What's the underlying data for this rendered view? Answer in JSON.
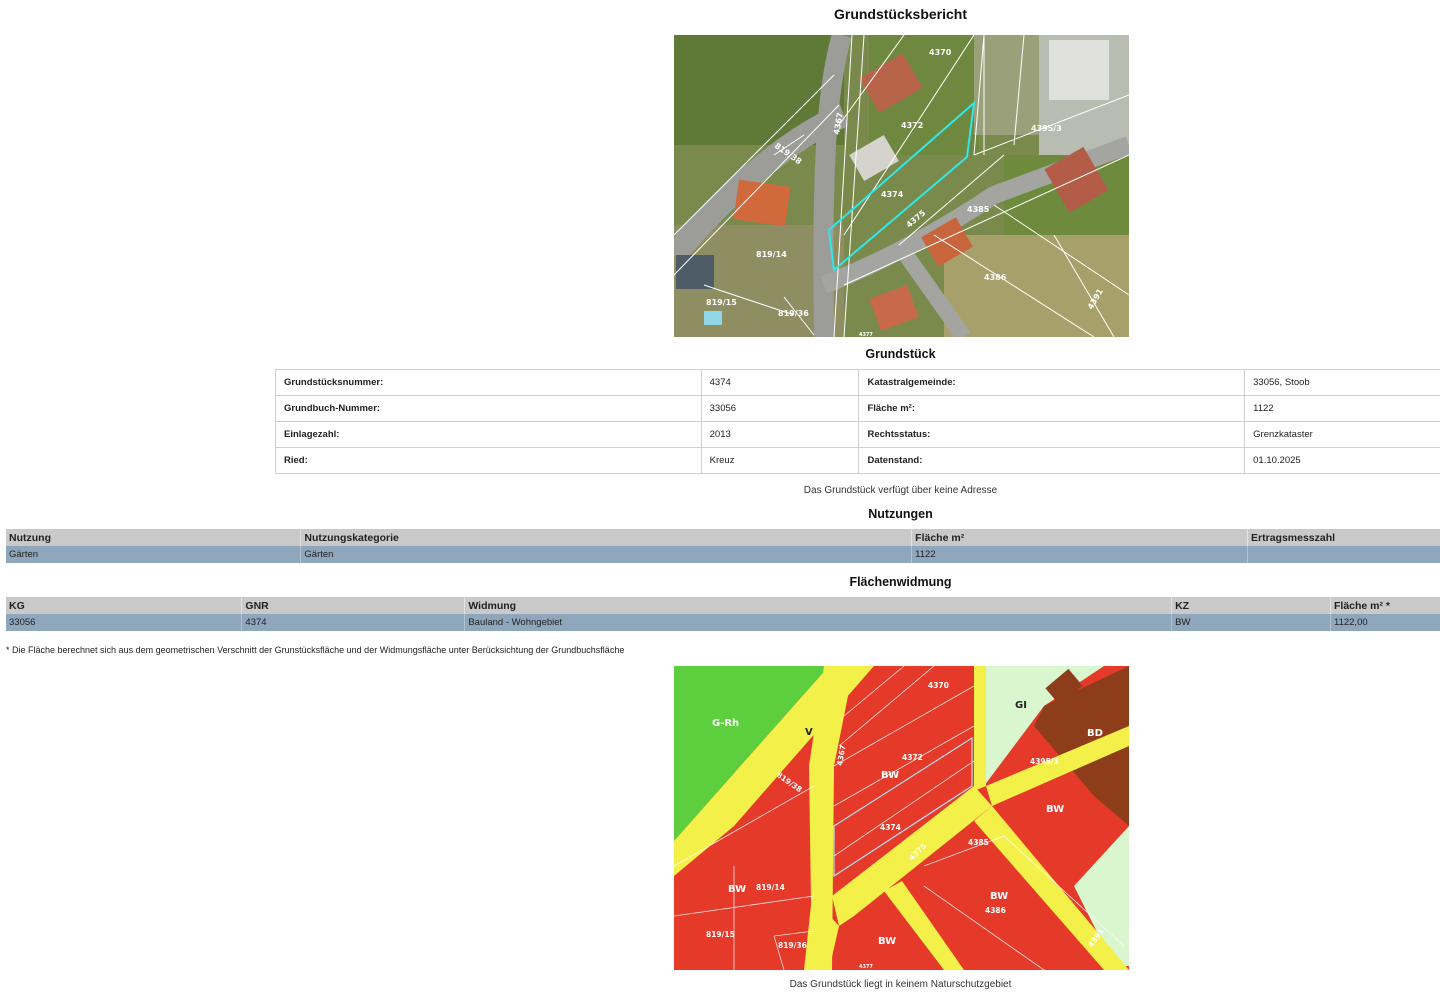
{
  "report": {
    "title": "Grundstücksbericht"
  },
  "aerial_map": {
    "parcel_labels": [
      "4370",
      "4372",
      "4374",
      "4395/3",
      "819/38",
      "4367",
      "4385",
      "4375",
      "819/14",
      "4386",
      "819/15",
      "819/36",
      "4391",
      "4377"
    ]
  },
  "parcel": {
    "heading": "Grundstück",
    "rows": [
      {
        "label1": "Grundstücksnummer:",
        "value1": "4374",
        "label2": "Katastralgemeinde:",
        "value2": "33056, Stoob"
      },
      {
        "label1": "Grundbuch-Nummer:",
        "value1": "33056",
        "label2": "Fläche m²:",
        "value2": "1122"
      },
      {
        "label1": "Einlagezahl:",
        "value1": "2013",
        "label2": "Rechtsstatus:",
        "value2": "Grenzkataster"
      },
      {
        "label1": "Ried:",
        "value1": "Kreuz",
        "label2": "Datenstand:",
        "value2": "01.10.2025"
      }
    ],
    "address_note": "Das Grundstück verfügt über keine Adresse"
  },
  "usage": {
    "heading": "Nutzungen",
    "columns": [
      "Nutzung",
      "Nutzungskategorie",
      "Fläche m²",
      "Ertragsmesszahl"
    ],
    "row": [
      "Gärten",
      "Gärten",
      "1122",
      ""
    ]
  },
  "zoning": {
    "heading": "Flächenwidmung",
    "columns": [
      "KG",
      "GNR",
      "Widmung",
      "KZ",
      "Fläche m² *"
    ],
    "row": [
      "33056",
      "4374",
      "Bauland - Wohngebiet",
      "BW",
      "1122,00"
    ],
    "footnote": "* Die Fläche berechnet sich aus dem geometrischen Verschnitt der Grunstücksfläche und der Widmungsfläche unter Berücksichtung der Grundbuchsfläche"
  },
  "zoning_map": {
    "zone_labels": [
      "G-Rh",
      "V",
      "GI",
      "BD",
      "BW",
      "BW",
      "BW",
      "BW",
      "BW",
      "BW"
    ],
    "parcel_labels": [
      "4370",
      "4372",
      "4374",
      "4395/3",
      "819/38",
      "4367",
      "4385",
      "4375",
      "819/14",
      "4386",
      "819/15",
      "819/36",
      "4391",
      "4377"
    ],
    "colors": {
      "residential": "#e53a2a",
      "road": "#f4f04a",
      "green": "#5dcf3e",
      "industrial": "#d9f6cf",
      "special": "#8e3d1a"
    }
  },
  "protection_note": "Das Grundstück liegt in keinem Naturschutzgebiet"
}
